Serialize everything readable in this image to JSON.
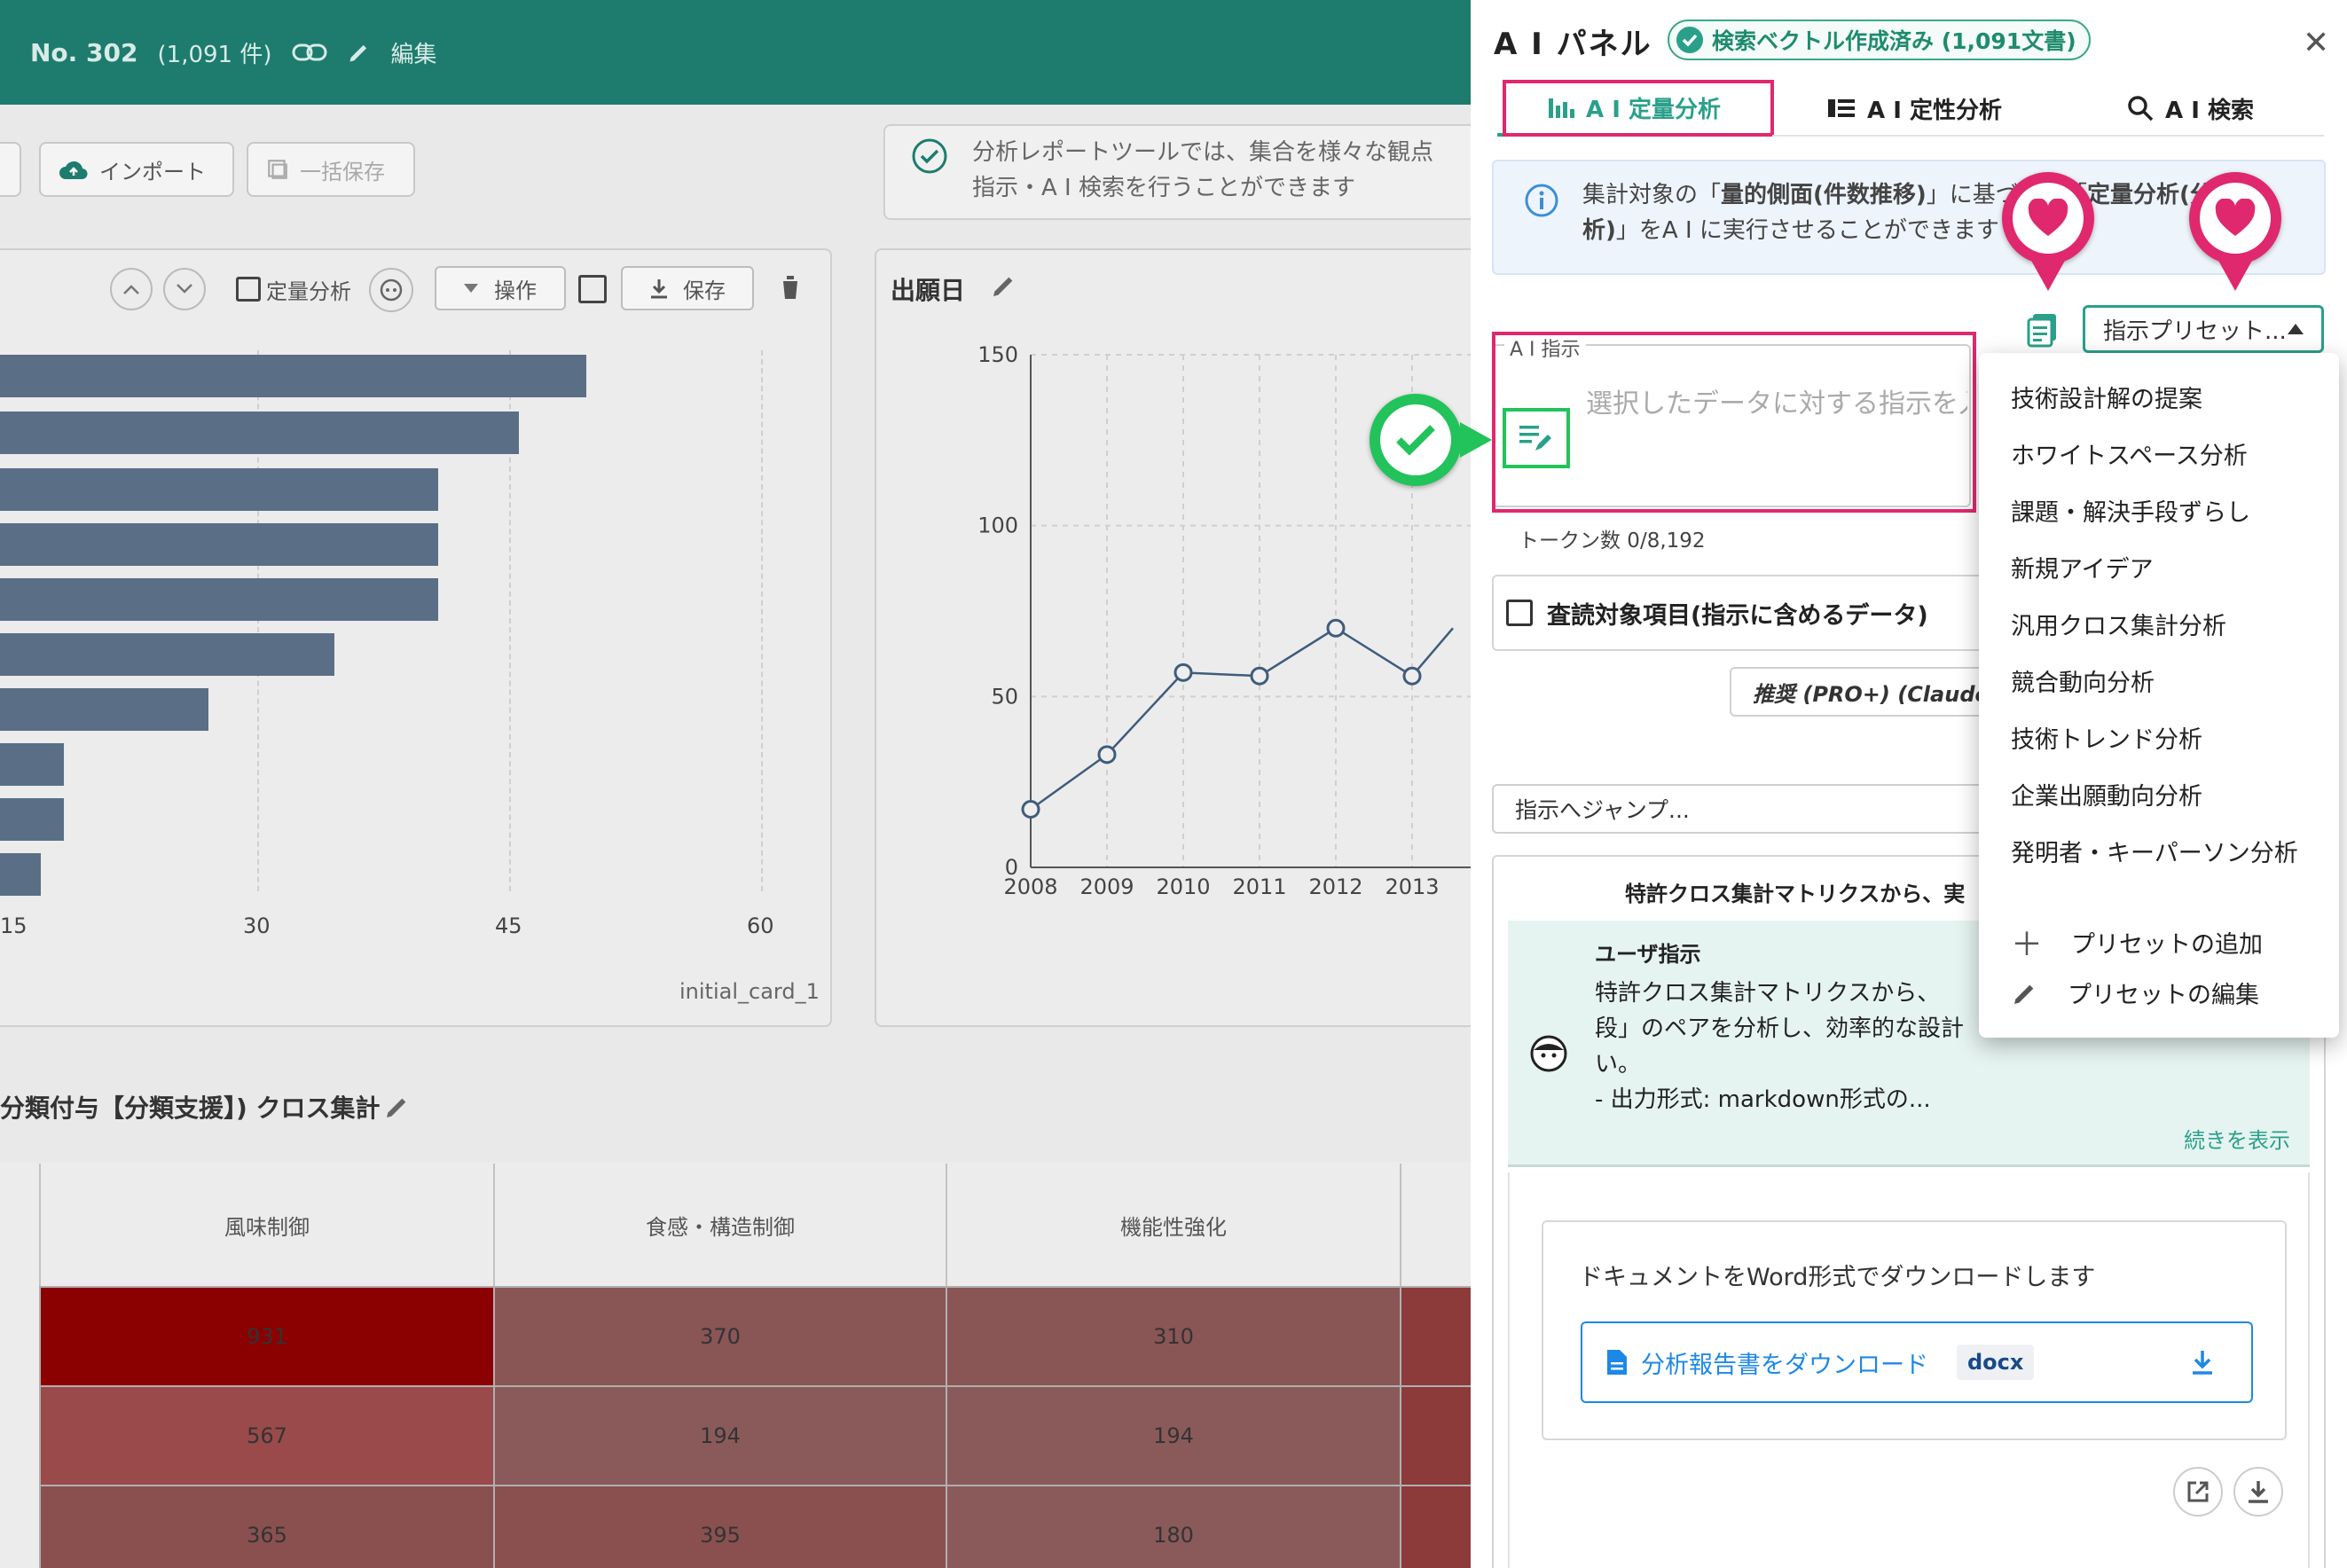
{
  "header": {
    "number": "No. 302",
    "count": "(1,091 件)",
    "edit_label": "編集"
  },
  "toolbar": {
    "import_label": "インポート",
    "bulk_save_label": "一括保存"
  },
  "info_message": {
    "line1": "分析レポートツールでは、集合を様々な観点",
    "line2": "指示・A I 検索を行うことができます"
  },
  "bar_card": {
    "quant_label": "定量分析",
    "op_label": "操作",
    "save_label": "保存",
    "footer": "initial_card_1",
    "x_ticks": [
      "15",
      "30",
      "45",
      "60"
    ],
    "bar_values": [
      49.6,
      45.6,
      40.8,
      40.8,
      40.8,
      34.6,
      27.1,
      18.5,
      18.5,
      17.1
    ]
  },
  "line_card": {
    "title": "出願日",
    "chart_data": {
      "type": "line",
      "x": [
        "2008",
        "2009",
        "2010",
        "2011",
        "2012",
        "2013"
      ],
      "values": [
        17,
        33,
        57,
        56,
        70,
        56
      ],
      "ylim": [
        0,
        150
      ],
      "y_ticks": [
        "0",
        "50",
        "100",
        "150"
      ]
    }
  },
  "cross_table": {
    "title": "分類付与【分類支援】) クロス集計",
    "columns": [
      "風味制御",
      "食感・構造制御",
      "機能性強化"
    ],
    "rows": [
      [
        "931",
        "370",
        "310"
      ],
      [
        "567",
        "194",
        "194"
      ],
      [
        "365",
        "395",
        "180"
      ]
    ],
    "colors": [
      "#8b0000",
      "#8b5757",
      "#b05050"
    ]
  },
  "panel": {
    "title": "A I パネル",
    "badge": "検索ベクトル作成済み (1,091文書)",
    "tabs": [
      "A I 定量分析",
      "A I 定性分析",
      "A I 検索"
    ],
    "info_line1_pre": "集計対象の「",
    "info_line1_bold": "量的側面(件数推移)",
    "info_line1_post": "」に基づいて「",
    "info_line1_bold2": "定量分析(分",
    "info_line2_bold": "析)",
    "info_line2_post": "」をA I に実行させることができます",
    "preset_label": "指示プリセット...",
    "ai_field_label": "A I 指示",
    "ai_placeholder": "選択したデータに対する指示を入力",
    "token_count": "トークン数 0/8,192",
    "review_label": "査読対象項目(指示に含めるデータ)",
    "model_label": "推奨 (PRO+) (Claude S",
    "jump_label": "指示へジャンプ...",
    "chat_header": "特許クロス集計マトリクスから、実",
    "user_title": "ユーザ指示",
    "user_line1": "特許クロス集計マトリクスから、",
    "user_line2": "段」のペアを分析し、効率的な設計",
    "user_line3": "い。",
    "user_line4": "- 出力形式: markdown形式の...",
    "show_more": "続きを表示",
    "dl_text": "ドキュメントをWord形式でダウンロードします",
    "dl_button": "分析報告書をダウンロード",
    "dl_ext": "docx"
  },
  "preset_menu": {
    "items": [
      "技術設計解の提案",
      "ホワイトスペース分析",
      "課題・解決手段ずらし",
      "新規アイデア",
      "汎用クロス集計分析",
      "競合動向分析",
      "技術トレンド分析",
      "企業出願動向分析",
      "発明者・キーパーソン分析"
    ],
    "add_label": "プリセットの追加",
    "edit_label": "プリセットの編集"
  },
  "colors": {
    "accent": "#2aa08a",
    "highlight": "#e0286e",
    "check": "#22c35a",
    "bar": "#5a6f86"
  }
}
